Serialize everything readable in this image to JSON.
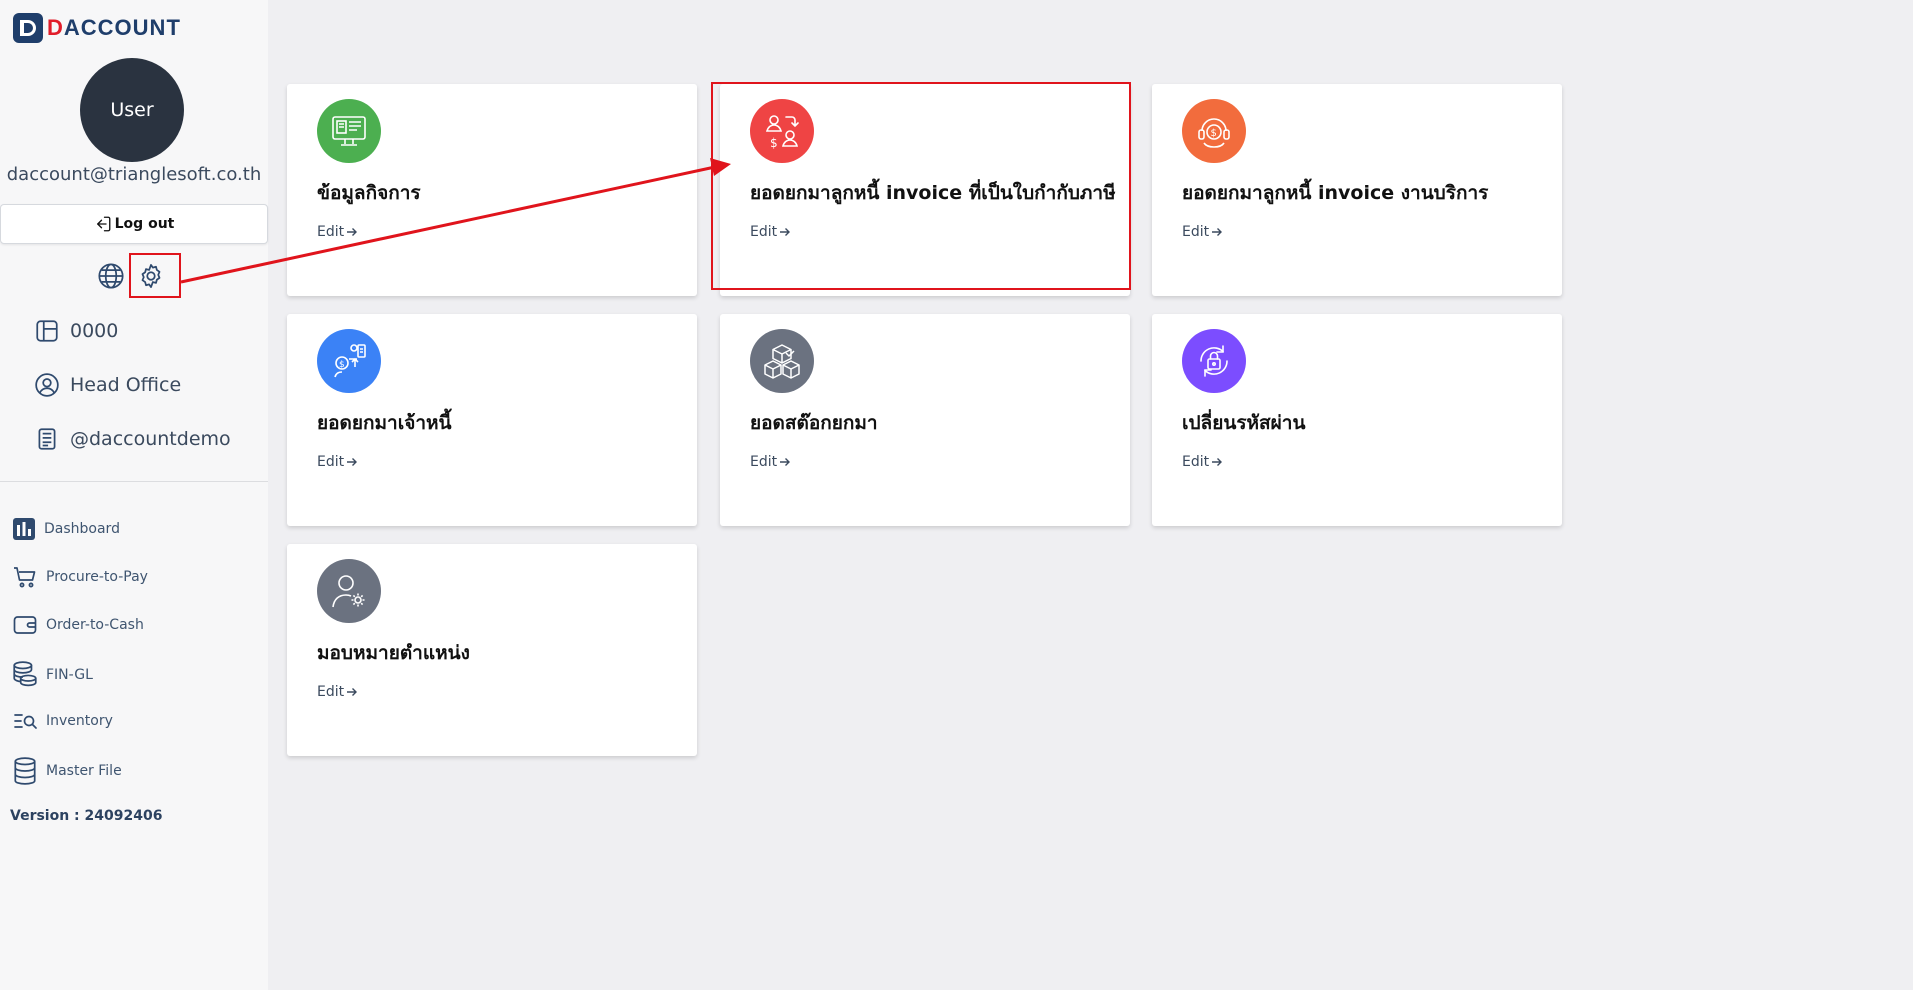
{
  "brand": {
    "mark_letter": "D",
    "name_accent": "D",
    "name_rest": "ACCOUNT"
  },
  "user": {
    "avatar_label": "User",
    "email": "daccount@trianglesoft.co.th"
  },
  "logout_label": "Log out",
  "info_items": [
    {
      "label": "0000",
      "icon": "layout-icon"
    },
    {
      "label": "Head Office",
      "icon": "user-circle-icon"
    },
    {
      "label": "@daccountdemo",
      "icon": "document-icon"
    }
  ],
  "nav": [
    {
      "label": "Dashboard",
      "icon": "bar-chart-icon"
    },
    {
      "label": "Procure-to-Pay",
      "icon": "cart-icon"
    },
    {
      "label": "Order-to-Cash",
      "icon": "wallet-icon"
    },
    {
      "label": "FIN-GL",
      "icon": "coins-icon"
    },
    {
      "label": "Inventory",
      "icon": "list-search-icon"
    },
    {
      "label": "Master File",
      "icon": "database-icon"
    }
  ],
  "version": "Version : 24092406",
  "cards": [
    {
      "title": "ข้อมูลกิจการ",
      "edit": "Edit",
      "color": "#4caf50",
      "icon": "business-info-icon"
    },
    {
      "title": "ยอดยกมาลูกหนี้ invoice ที่เป็นใบกำกับภาษี",
      "edit": "Edit",
      "color": "#ef4444",
      "icon": "debtor-exchange-icon"
    },
    {
      "title": "ยอดยกมาลูกหนี้ invoice งานบริการ",
      "edit": "Edit",
      "color": "#f26c3d",
      "icon": "service-money-icon"
    },
    {
      "title": "ยอดยกมาเจ้าหนี้",
      "edit": "Edit",
      "color": "#3b82f6",
      "icon": "creditor-icon"
    },
    {
      "title": "ยอดสต๊อกยกมา",
      "edit": "Edit",
      "color": "#6b7280",
      "icon": "boxes-icon"
    },
    {
      "title": "เปลี่ยนรหัสผ่าน",
      "edit": "Edit",
      "color": "#7c4dff",
      "icon": "lock-refresh-icon"
    },
    {
      "title": "มอบหมายตำแหน่ง",
      "edit": "Edit",
      "color": "#6b7280",
      "icon": "user-gear-icon"
    }
  ],
  "colors": {
    "annotation": "#e0141c",
    "brand_blue": "#1f3e6b",
    "brand_red": "#e11d2a"
  }
}
